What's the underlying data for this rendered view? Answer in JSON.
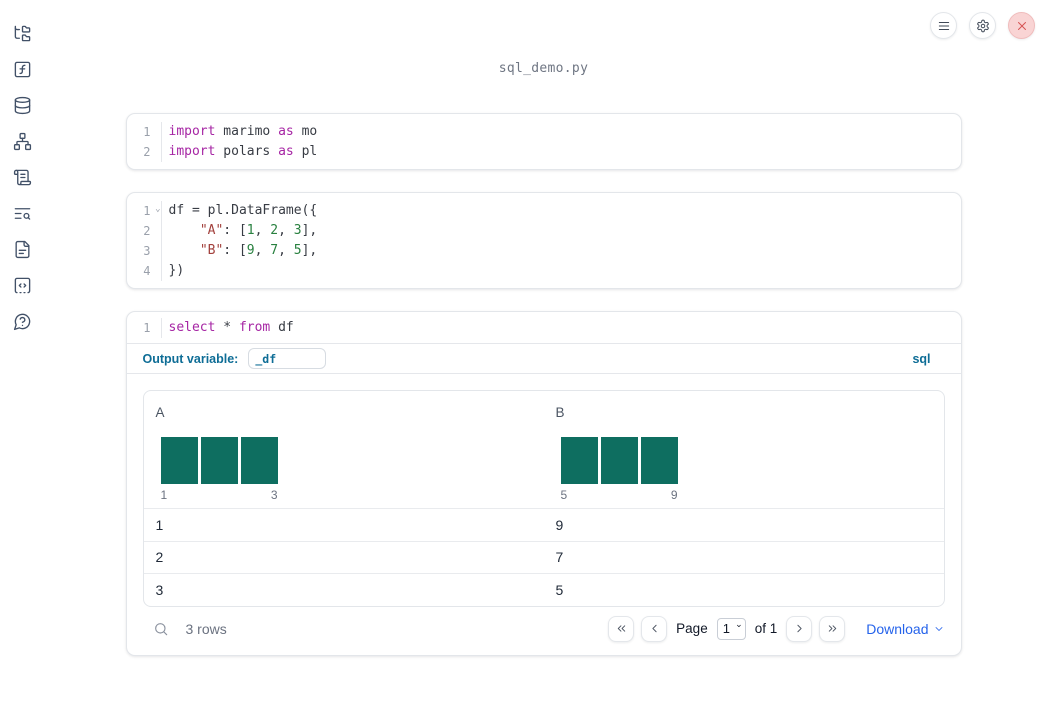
{
  "window": {
    "title": "sql_demo.py"
  },
  "topbar": {
    "menu_button": "menu",
    "settings_button": "settings",
    "close_button": "close"
  },
  "sidebar": {
    "items": [
      {
        "icon": "file-tree"
      },
      {
        "icon": "function-square"
      },
      {
        "icon": "database"
      },
      {
        "icon": "dependency-graph"
      },
      {
        "icon": "scroll"
      },
      {
        "icon": "list-search"
      },
      {
        "icon": "document"
      },
      {
        "icon": "code-snippet"
      },
      {
        "icon": "help-bubble"
      }
    ]
  },
  "cells": [
    {
      "kind": "python",
      "lines": [
        {
          "num": "1",
          "tokens": [
            {
              "t": "import",
              "c": "kw"
            },
            {
              "t": " marimo ",
              "c": ""
            },
            {
              "t": "as",
              "c": "kw"
            },
            {
              "t": " mo",
              "c": ""
            }
          ]
        },
        {
          "num": "2",
          "tokens": [
            {
              "t": "import",
              "c": "kw"
            },
            {
              "t": " polars ",
              "c": ""
            },
            {
              "t": "as",
              "c": "kw"
            },
            {
              "t": " pl",
              "c": ""
            }
          ]
        }
      ]
    },
    {
      "kind": "python",
      "lines": [
        {
          "num": "1",
          "fold": true,
          "tokens": [
            {
              "t": "df = pl.DataFrame({",
              "c": ""
            }
          ]
        },
        {
          "num": "2",
          "tokens": [
            {
              "t": "    ",
              "c": ""
            },
            {
              "t": "\"A\"",
              "c": "str"
            },
            {
              "t": ": [",
              "c": ""
            },
            {
              "t": "1",
              "c": "num"
            },
            {
              "t": ", ",
              "c": ""
            },
            {
              "t": "2",
              "c": "num"
            },
            {
              "t": ", ",
              "c": ""
            },
            {
              "t": "3",
              "c": "num"
            },
            {
              "t": "],",
              "c": ""
            }
          ]
        },
        {
          "num": "3",
          "tokens": [
            {
              "t": "    ",
              "c": ""
            },
            {
              "t": "\"B\"",
              "c": "str"
            },
            {
              "t": ": [",
              "c": ""
            },
            {
              "t": "9",
              "c": "num"
            },
            {
              "t": ", ",
              "c": ""
            },
            {
              "t": "7",
              "c": "num"
            },
            {
              "t": ", ",
              "c": ""
            },
            {
              "t": "5",
              "c": "num"
            },
            {
              "t": "],",
              "c": ""
            }
          ]
        },
        {
          "num": "4",
          "tokens": [
            {
              "t": "})",
              "c": ""
            }
          ]
        }
      ]
    },
    {
      "kind": "sql",
      "lines": [
        {
          "num": "1",
          "tokens": [
            {
              "t": "select",
              "c": "kw"
            },
            {
              "t": " * ",
              "c": ""
            },
            {
              "t": "from",
              "c": "kw"
            },
            {
              "t": " df",
              "c": ""
            }
          ]
        }
      ]
    }
  ],
  "sql_cell": {
    "output_variable_label": "Output variable:",
    "output_variable_value": "_df",
    "language": "sql"
  },
  "table": {
    "columns": [
      {
        "name": "A",
        "histogram": {
          "bar_values": [
            1,
            1,
            1
          ],
          "min_label": "1",
          "max_label": "3"
        }
      },
      {
        "name": "B",
        "histogram": {
          "bar_values": [
            1,
            1,
            1
          ],
          "min_label": "5",
          "max_label": "9"
        }
      }
    ],
    "rows": [
      [
        "1",
        "9"
      ],
      [
        "2",
        "7"
      ],
      [
        "3",
        "5"
      ]
    ]
  },
  "table_footer": {
    "rows_text": "3 rows",
    "page_label": "Page",
    "page_options": [
      "1"
    ],
    "page_value": "1",
    "of_text": "of 1",
    "download_text": "Download"
  },
  "colors": {
    "histogram_teal": "#0e6e60",
    "accent_blue": "#0e6d96",
    "link_blue": "#2563eb",
    "keyword_purple": "#a626a4",
    "string_red": "#a2403c",
    "number_green": "#28803f",
    "close_red": "#d65454"
  }
}
